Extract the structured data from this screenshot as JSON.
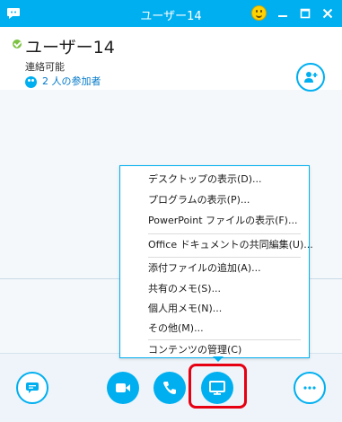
{
  "window": {
    "title": "ユーザー14"
  },
  "header": {
    "user_name": "ユーザー14",
    "status": "連絡可能",
    "participants": "2 人の参加者"
  },
  "menu": {
    "items": [
      {
        "label": "デスクトップの表示(D)..."
      },
      {
        "label": "プログラムの表示(P)..."
      },
      {
        "label": "PowerPoint ファイルの表示(F)..."
      },
      {
        "label": "Office ドキュメントの共同編集(U)..."
      },
      {
        "label": "添付ファイルの追加(A)..."
      },
      {
        "label": "共有のメモ(S)..."
      },
      {
        "label": "個人用メモ(N)..."
      },
      {
        "label": "その他(M)..."
      },
      {
        "label": "コンテンツの管理(C)"
      }
    ]
  },
  "colors": {
    "accent": "#00aff0",
    "highlight": "#e60012",
    "status_ok": "#7cc242"
  },
  "icons": [
    "chat-bubble-icon",
    "smiley-icon",
    "minimize-icon",
    "maximize-icon",
    "close-icon",
    "add-contact-icon",
    "participants-icon",
    "video-icon",
    "phone-icon",
    "present-screen-icon",
    "more-icon"
  ]
}
